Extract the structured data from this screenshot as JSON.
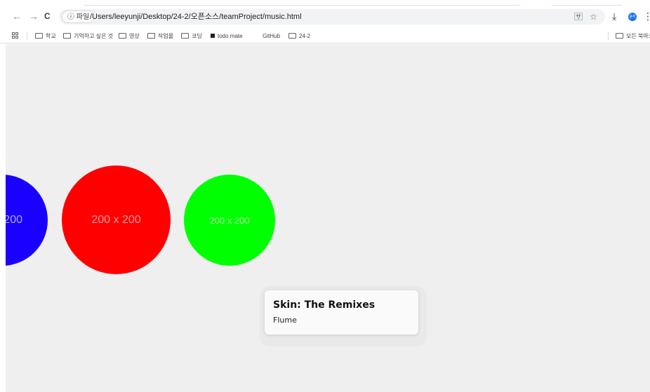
{
  "browser": {
    "nav": {
      "back": "←",
      "forward": "→",
      "reload": "C"
    },
    "omnibox": {
      "chip_label": "ⓘ 파일",
      "url": "/Users/leeyunji/Desktop/24-2/오픈소스/teamProject/music.html"
    },
    "icons": {
      "translate": "🈂",
      "star": "☆",
      "download": "⤓",
      "menu": "⋮"
    },
    "avatar_text": "윤지",
    "bookmarks": [
      {
        "label": "학교",
        "kind": "folder"
      },
      {
        "label": "기억하고 싶은 것",
        "kind": "folder"
      },
      {
        "label": "영상",
        "kind": "folder"
      },
      {
        "label": "작업물",
        "kind": "folder"
      },
      {
        "label": "코딩",
        "kind": "folder"
      },
      {
        "label": "todo mate",
        "kind": "site"
      },
      {
        "label": "GitHub",
        "kind": "site"
      },
      {
        "label": "24-2",
        "kind": "folder"
      }
    ],
    "all_bookmarks_label": "모든 북마크"
  },
  "page": {
    "circles": [
      {
        "label": "200",
        "color": "#1a00ff",
        "text_color": "#b3acf6"
      },
      {
        "label": "200 x 200",
        "color": "#ff0000",
        "text_color": "#ff9a9a"
      },
      {
        "label": "200 x 200",
        "color": "#00ff00",
        "text_color": "#a8f5a0"
      }
    ],
    "card": {
      "title": "Skin: The Remixes",
      "artist": "Flume"
    }
  },
  "colors": {
    "page_background": "#efefef",
    "card_background": "#fafafa"
  }
}
